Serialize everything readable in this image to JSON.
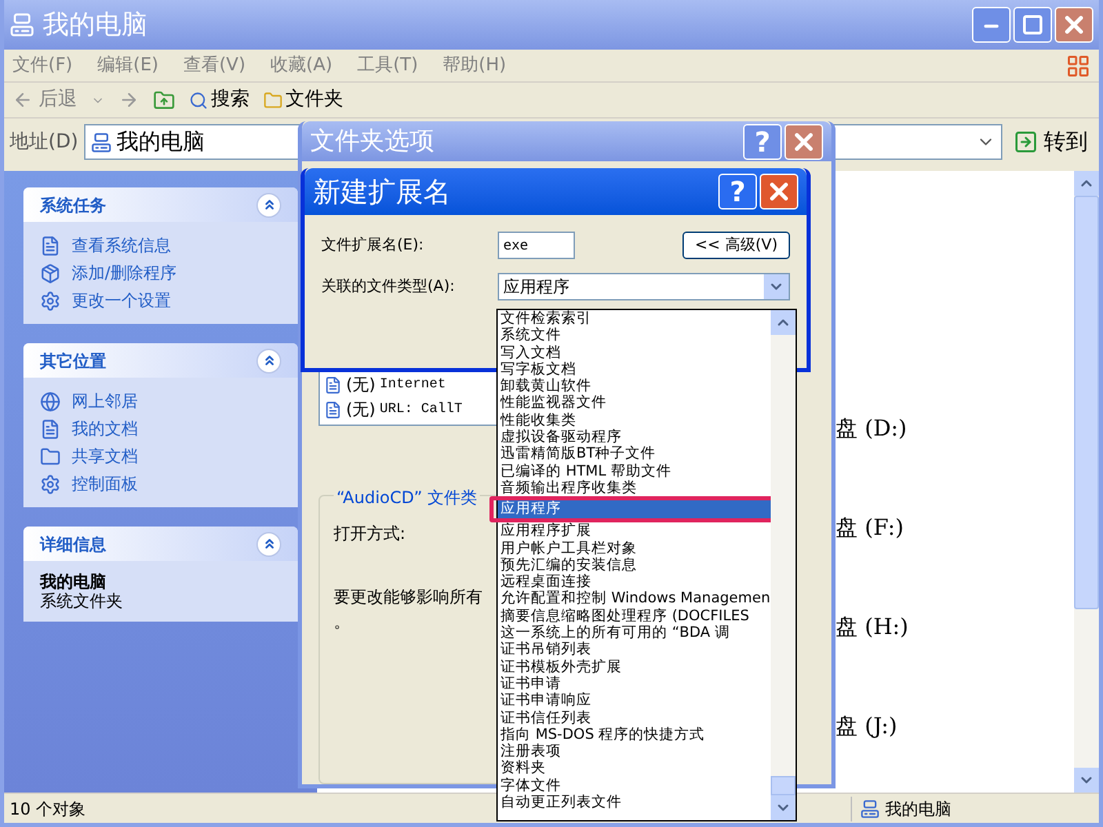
{
  "window": {
    "title": "我的电脑"
  },
  "menu": [
    "文件(F)",
    "编辑(E)",
    "查看(V)",
    "收藏(A)",
    "工具(T)",
    "帮助(H)"
  ],
  "toolbar": {
    "back": "后退",
    "search": "搜索",
    "folders": "文件夹"
  },
  "address": {
    "label": "地址(D)",
    "value": "我的电脑",
    "go": "转到"
  },
  "task_panes": [
    {
      "title": "系统任务",
      "expanded": true,
      "items": [
        "查看系统信息",
        "添加/删除程序",
        "更改一个设置"
      ]
    },
    {
      "title": "其它位置",
      "expanded": true,
      "items": [
        "网上邻居",
        "我的文档",
        "共享文档",
        "控制面板"
      ]
    },
    {
      "title": "详细信息",
      "expanded": true,
      "details": {
        "name": "我的电脑",
        "type": "系统文件夹"
      }
    }
  ],
  "drives": [
    "盘 (D:)",
    "盘 (F:)",
    "盘 (H:)",
    "盘 (J:)"
  ],
  "status_bar": {
    "count": "10 个对象",
    "location": "我的电脑"
  },
  "folder_options": {
    "title": "文件夹选项",
    "help": "?",
    "file_types": [
      {
        "extension": "(无)",
        "type": "Internet"
      },
      {
        "extension": "(无)",
        "type": "URL: CallT"
      }
    ],
    "group_title": "“AudioCD” 文件类",
    "opens_with_label": "打开方式:",
    "note": "要更改能够影响所有",
    "note_end": "。"
  },
  "new_extension": {
    "title": "新建扩展名",
    "help": "?",
    "extension_label": "文件扩展名(E):",
    "extension_value": "exe",
    "advanced_button": "<< 高级(V)",
    "type_label": "关联的文件类型(A):",
    "type_value": "应用程序",
    "options": [
      {
        "label": "文件检索索引",
        "selected": false
      },
      {
        "label": "系统文件",
        "selected": false
      },
      {
        "label": "写入文档",
        "selected": false
      },
      {
        "label": "写字板文档",
        "selected": false
      },
      {
        "label": "卸载黄山软件",
        "selected": false
      },
      {
        "label": "性能监视器文件",
        "selected": false
      },
      {
        "label": "性能收集类",
        "selected": false
      },
      {
        "label": "虚拟设备驱动程序",
        "selected": false
      },
      {
        "label": "迅雷精简版BT种子文件",
        "selected": false
      },
      {
        "label": "已编译的 HTML 帮助文件",
        "selected": false
      },
      {
        "label": "音频输出程序收集类",
        "selected": false
      },
      {
        "label": "应用程序",
        "selected": true
      },
      {
        "label": "应用程序扩展",
        "selected": false
      },
      {
        "label": "用户帐户工具栏对象",
        "selected": false
      },
      {
        "label": "预先汇编的安装信息",
        "selected": false
      },
      {
        "label": "远程桌面连接",
        "selected": false
      },
      {
        "label": "允许配置和控制 Windows Managemen",
        "selected": false
      },
      {
        "label": "摘要信息缩略图处理程序 (DOCFILES",
        "selected": false
      },
      {
        "label": "这一系统上的所有可用的 “BDA 调",
        "selected": false
      },
      {
        "label": "证书吊销列表",
        "selected": false
      },
      {
        "label": "证书模板外壳扩展",
        "selected": false
      },
      {
        "label": "证书申请",
        "selected": false
      },
      {
        "label": "证书申请响应",
        "selected": false
      },
      {
        "label": "证书信任列表",
        "selected": false
      },
      {
        "label": "指向 MS-DOS 程序的快捷方式",
        "selected": false
      },
      {
        "label": "注册表项",
        "selected": false
      },
      {
        "label": "资料夹",
        "selected": false
      },
      {
        "label": "字体文件",
        "selected": false
      },
      {
        "label": "自动更正列表文件",
        "selected": false
      }
    ]
  }
}
